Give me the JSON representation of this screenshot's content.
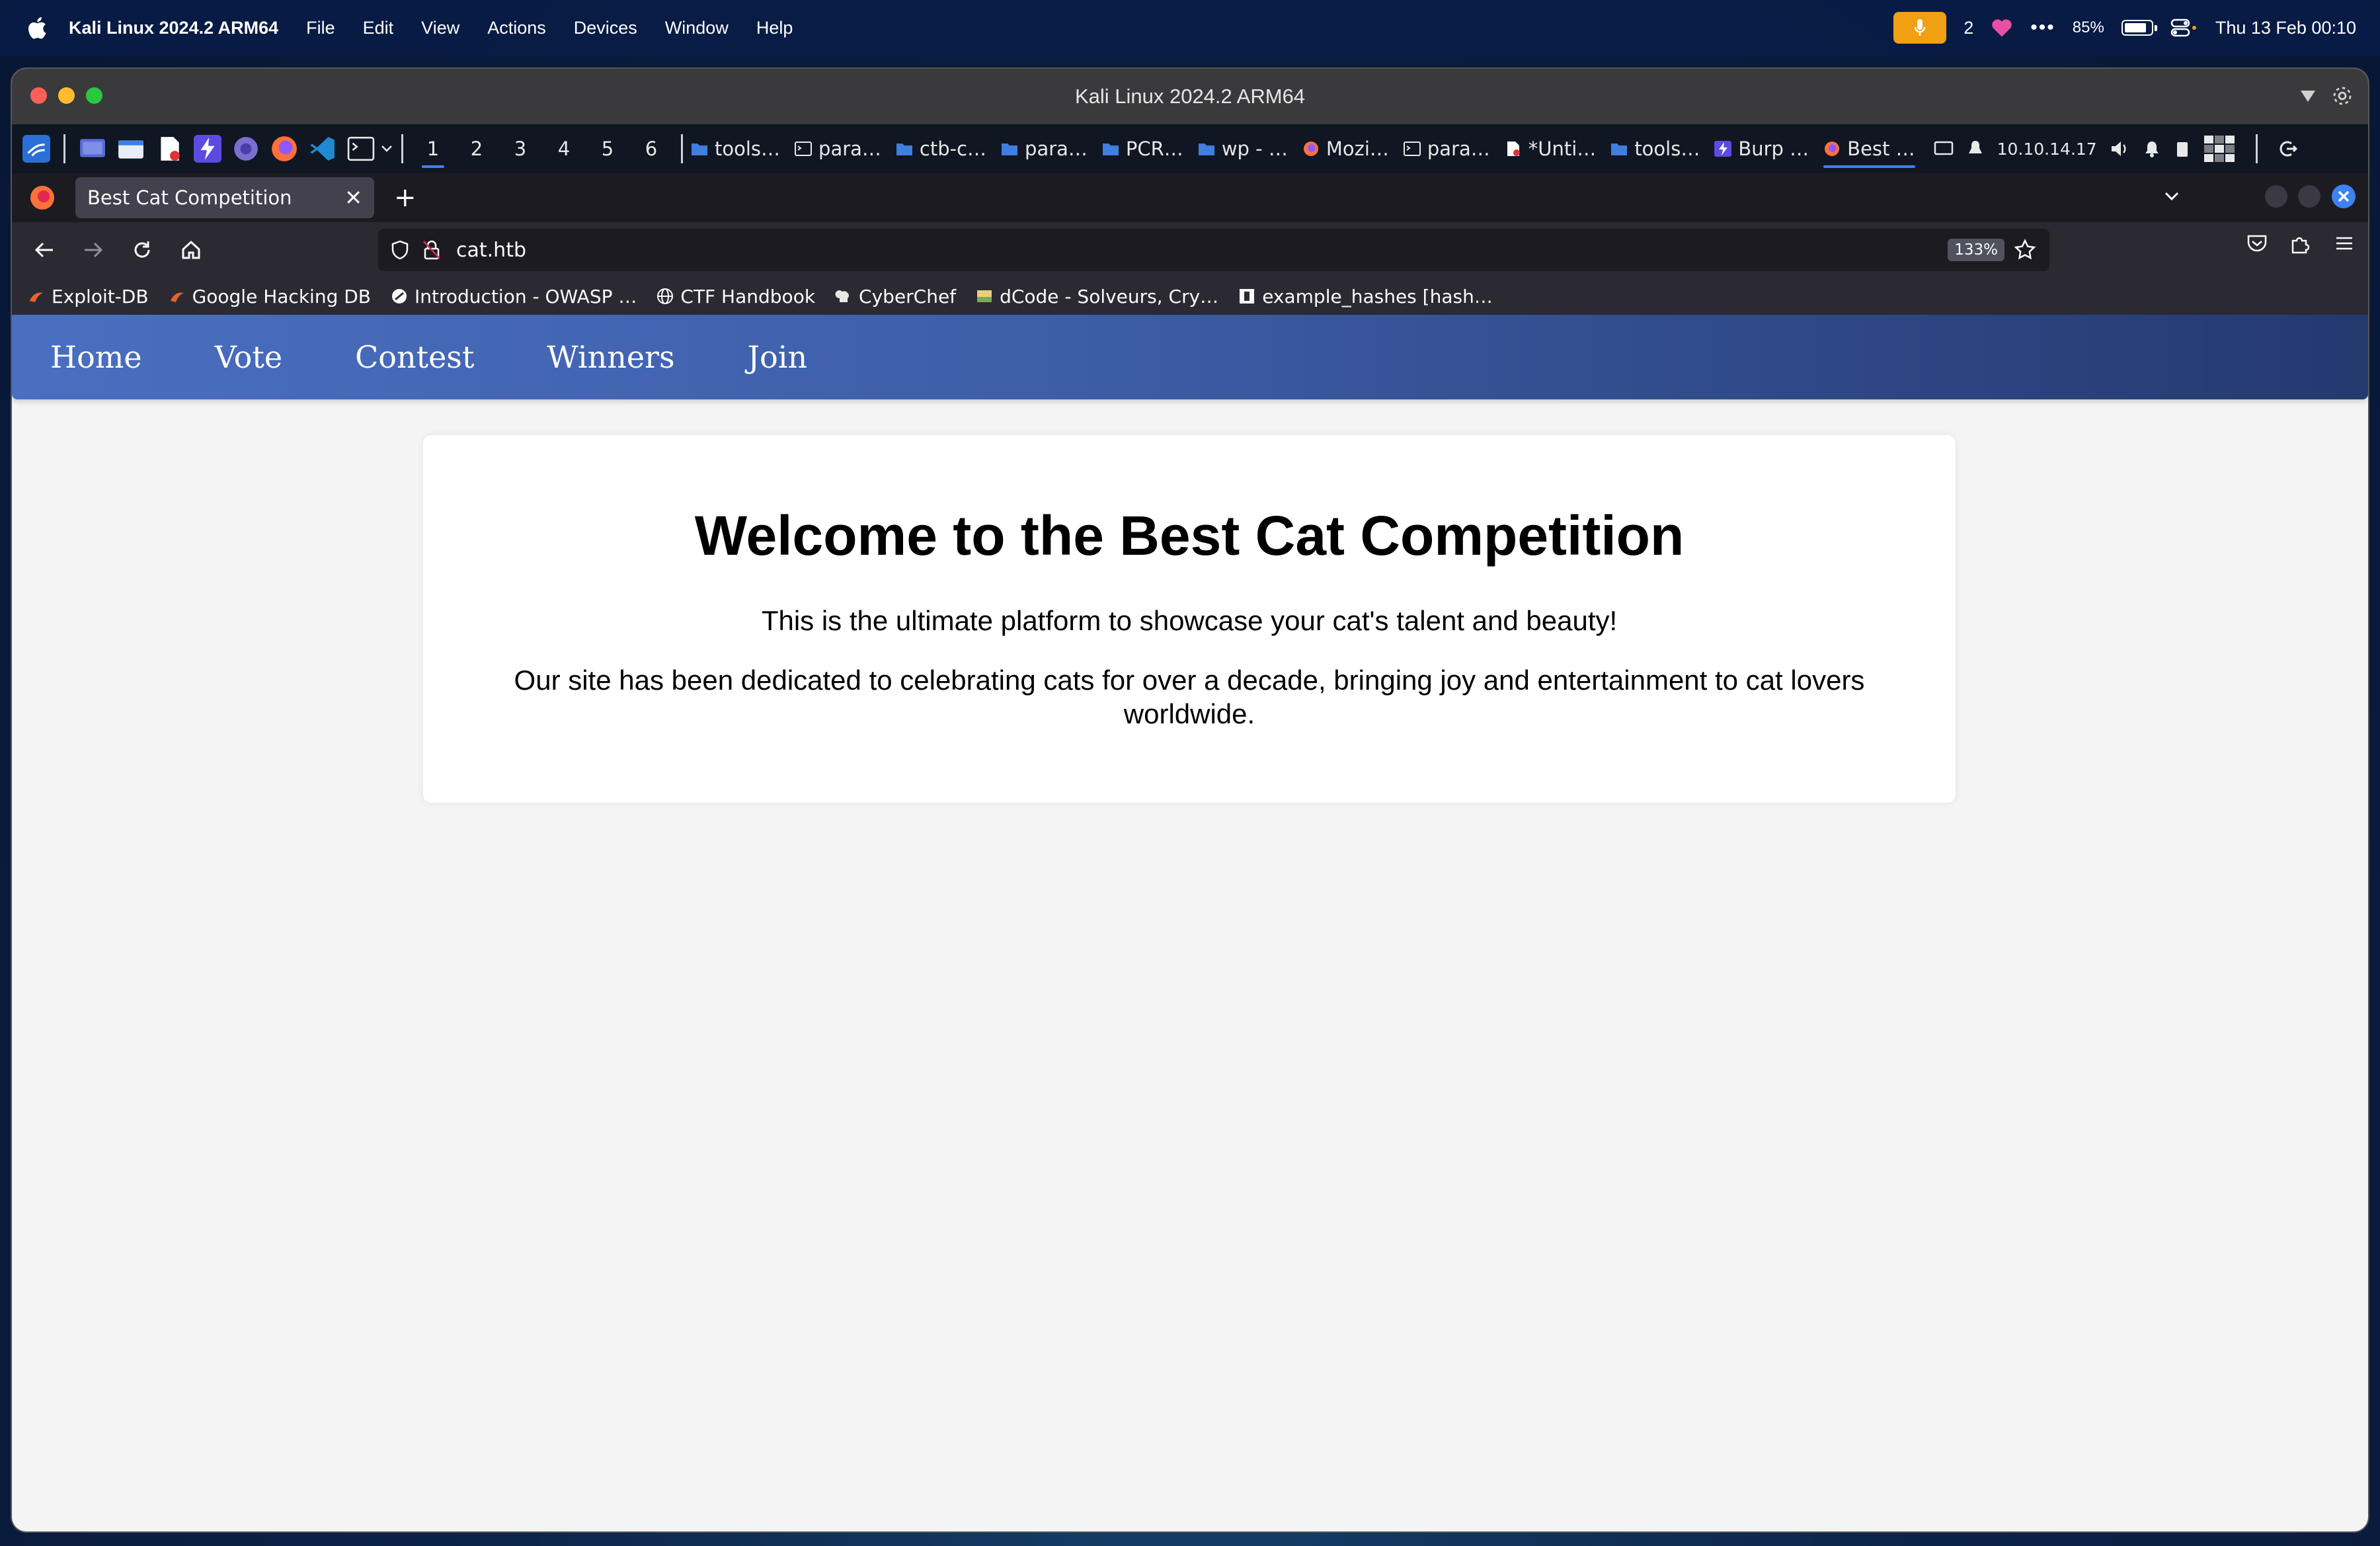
{
  "menubar": {
    "app_name": "Kali Linux 2024.2 ARM64",
    "items": [
      "File",
      "Edit",
      "View",
      "Actions",
      "Devices",
      "Window",
      "Help"
    ],
    "notif_count": "2",
    "battery": "85%",
    "datetime": "Thu 13 Feb  00:10"
  },
  "window": {
    "title": "Kali Linux 2024.2 ARM64"
  },
  "panel": {
    "workspaces": [
      "1",
      "2",
      "3",
      "4",
      "5",
      "6"
    ],
    "active_workspace": "1",
    "tasks": [
      {
        "label": "tools…",
        "icon": "folder-icon"
      },
      {
        "label": "para…",
        "icon": "terminal-icon"
      },
      {
        "label": "ctb-c…",
        "icon": "folder-icon"
      },
      {
        "label": "para…",
        "icon": "folder-icon"
      },
      {
        "label": "PCR…",
        "icon": "folder-icon"
      },
      {
        "label": "wp - …",
        "icon": "folder-icon"
      },
      {
        "label": "Mozi…",
        "icon": "firefox-icon"
      },
      {
        "label": "para…",
        "icon": "terminal-icon"
      },
      {
        "label": "*Unti…",
        "icon": "text-editor-icon"
      },
      {
        "label": "tools…",
        "icon": "folder-icon"
      },
      {
        "label": "Burp …",
        "icon": "burp-icon"
      },
      {
        "label": "Best …",
        "icon": "firefox-icon"
      }
    ],
    "ip": "10.10.14.17"
  },
  "browser": {
    "tab_title": "Best Cat Competition",
    "url": "cat.htb",
    "zoom": "133%",
    "bookmarks": [
      "Exploit-DB",
      "Google Hacking DB",
      "Introduction - OWASP …",
      "CTF Handbook",
      "CyberChef",
      "dCode - Solveurs, Cry…",
      "example_hashes [hash…"
    ]
  },
  "site": {
    "nav": [
      "Home",
      "Vote",
      "Contest",
      "Winners",
      "Join"
    ],
    "heading": "Welcome to the Best Cat Competition",
    "intro": "This is the ultimate platform to showcase your cat's talent and beauty!",
    "body": "Our site has been dedicated to celebrating cats for over a decade, bringing joy and entertainment to cat lovers worldwide."
  },
  "colors": {
    "nav_gradient_start": "#4a6fc0",
    "nav_gradient_end": "#24396e",
    "page_bg": "#f4f4f4",
    "accent_blue": "#3d82f0",
    "mic_orange": "#f0a012"
  }
}
